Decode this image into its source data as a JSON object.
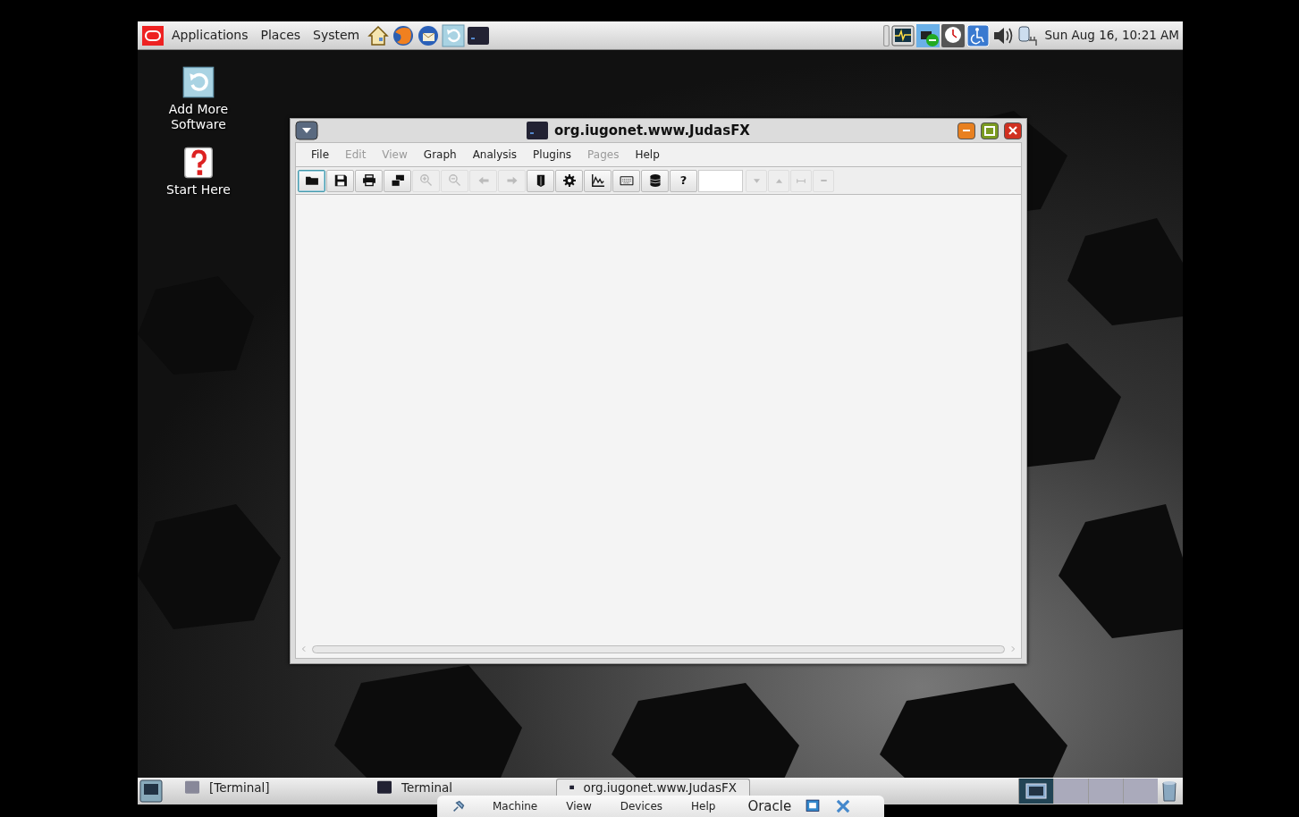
{
  "top_panel": {
    "menus": [
      "Applications",
      "Places",
      "System"
    ],
    "launchers": [
      {
        "kind": "home"
      },
      {
        "kind": "browser"
      },
      {
        "kind": "mail"
      },
      {
        "kind": "update"
      },
      {
        "kind": "terminal"
      }
    ],
    "tray": [
      {
        "kind": "monitor"
      },
      {
        "kind": "network"
      },
      {
        "kind": "clock"
      },
      {
        "kind": "accessibility"
      },
      {
        "kind": "volume"
      },
      {
        "kind": "power"
      }
    ],
    "clock": "Sun Aug 16, 10:21 AM"
  },
  "desktop_icons": [
    {
      "label": "Add More Software",
      "kind": "update"
    },
    {
      "label": "Start Here",
      "kind": "help"
    }
  ],
  "window": {
    "title": "org.iugonet.www.JudasFX",
    "menu": [
      {
        "label": "File",
        "disabled": false
      },
      {
        "label": "Edit",
        "disabled": true
      },
      {
        "label": "View",
        "disabled": true
      },
      {
        "label": "Graph",
        "disabled": false
      },
      {
        "label": "Analysis",
        "disabled": false
      },
      {
        "label": "Plugins",
        "disabled": false
      },
      {
        "label": "Pages",
        "disabled": true
      },
      {
        "label": "Help",
        "disabled": false
      }
    ],
    "toolbar": [
      {
        "kind": "open",
        "disabled": false,
        "selected": true
      },
      {
        "kind": "save",
        "disabled": false,
        "selected": false
      },
      {
        "kind": "print",
        "disabled": false,
        "selected": false
      },
      {
        "kind": "windows",
        "disabled": false,
        "selected": false
      },
      {
        "kind": "zoom-in",
        "disabled": true,
        "selected": false
      },
      {
        "kind": "zoom-out",
        "disabled": true,
        "selected": false
      },
      {
        "kind": "back",
        "disabled": true,
        "selected": false
      },
      {
        "kind": "forward",
        "disabled": true,
        "selected": false
      },
      {
        "kind": "book",
        "disabled": false,
        "selected": false
      },
      {
        "kind": "settings",
        "disabled": false,
        "selected": false
      },
      {
        "kind": "chart",
        "disabled": false,
        "selected": false
      },
      {
        "kind": "keyboard",
        "disabled": false,
        "selected": false
      },
      {
        "kind": "database",
        "disabled": false,
        "selected": false
      },
      {
        "kind": "text",
        "label": "?",
        "disabled": false,
        "selected": false
      },
      {
        "kind": "field"
      },
      {
        "kind": "dropdown",
        "disabled": true,
        "selected": false
      },
      {
        "kind": "up",
        "disabled": true,
        "selected": false
      },
      {
        "kind": "fit",
        "disabled": true,
        "selected": false
      },
      {
        "kind": "minus",
        "disabled": true,
        "selected": false
      }
    ]
  },
  "taskbar": {
    "tasks": [
      {
        "label": "[Terminal]",
        "selected": false
      },
      {
        "label": "Terminal",
        "selected": false
      },
      {
        "label": "org.iugonet.www.JudasFX",
        "selected": true
      }
    ],
    "workspaces": [
      {
        "selected": true
      },
      {
        "selected": false
      },
      {
        "selected": false
      },
      {
        "selected": false
      }
    ]
  },
  "vm_toolbar": {
    "menus": [
      "Machine",
      "View",
      "Devices",
      "Help"
    ],
    "brand": "Oracle"
  }
}
